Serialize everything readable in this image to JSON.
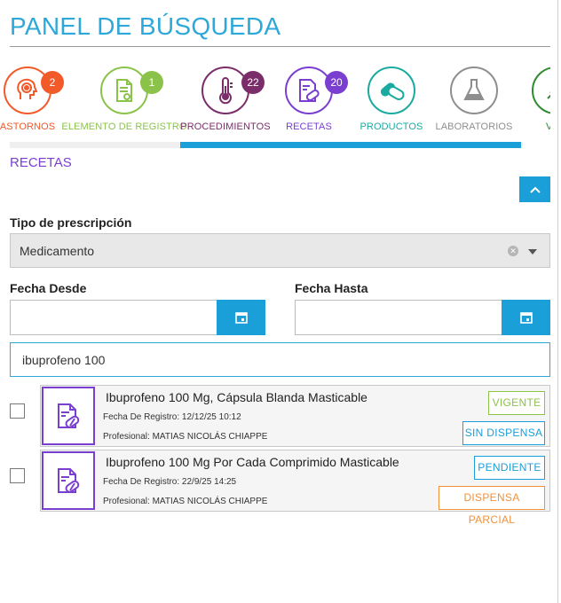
{
  "page": {
    "title": "PANEL DE BÚSQUEDA"
  },
  "categories": [
    {
      "label": "ASTORNOS",
      "count": "2",
      "color": "#f25a2a",
      "badge_color": "#f25a2a",
      "icon": "head-target-icon"
    },
    {
      "label": "ELEMENTO DE REGISTRO",
      "count": "1",
      "color": "#8bc34a",
      "badge_color": "#8bc34a",
      "icon": "document-check-icon"
    },
    {
      "label": "PROCEDIMIENTOS",
      "count": "22",
      "color": "#7b2d6a",
      "badge_color": "#7b2d6a",
      "icon": "thermometer-icon"
    },
    {
      "label": "RECETAS",
      "count": "20",
      "color": "#7a3fd0",
      "badge_color": "#7a3fd0",
      "icon": "prescription-pill-icon"
    },
    {
      "label": "PRODUCTOS",
      "count": "",
      "color": "#1aaaa0",
      "badge_color": "",
      "icon": "capsules-icon"
    },
    {
      "label": "LABORATORIOS",
      "count": "",
      "color": "#8e8e8e",
      "badge_color": "",
      "icon": "flask-icon"
    },
    {
      "label": "VAC",
      "count": "",
      "color": "#2e8b2e",
      "badge_color": "",
      "icon": "vaccine-icon"
    }
  ],
  "section": {
    "title": "RECETAS"
  },
  "filters": {
    "tipo_label": "Tipo de prescripción",
    "tipo_value": "Medicamento",
    "fecha_desde_label": "Fecha Desde",
    "fecha_desde_value": "",
    "fecha_hasta_label": "Fecha Hasta",
    "fecha_hasta_value": "",
    "search_value": "ibuprofeno 100"
  },
  "results": [
    {
      "name": "Ibuprofeno 100 Mg, Cápsula Blanda Masticable",
      "fecha": "Fecha De Registro: 12/12/25 10:12",
      "profesional": "Profesional: MATIAS NICOLÁS CHIAPPE",
      "status": "VIGENTE",
      "status_color": "#8bc34a",
      "dispensa": "SIN DISPENSA",
      "dispensa_color": "#1a9fd9"
    },
    {
      "name": "Ibuprofeno 100 Mg Por Cada Comprimido Masticable",
      "fecha": "Fecha De Registro: 22/9/25 14:25",
      "profesional": "Profesional: MATIAS NICOLÁS CHIAPPE",
      "status": "PENDIENTE",
      "status_color": "#1a9fd9",
      "dispensa": "DISPENSA PARCIAL",
      "dispensa_color": "#f0913a"
    }
  ],
  "colors": {
    "accent": "#1a9fd9",
    "title": "#2ea8d8",
    "section": "#7a3fd0"
  }
}
